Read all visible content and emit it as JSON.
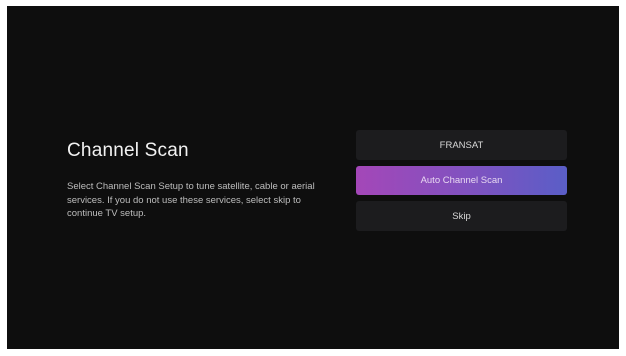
{
  "page": {
    "title": "Channel Scan",
    "description": "Select Channel Scan Setup to tune satellite, cable or aerial services. If you do not use these services, select skip to continue TV setup."
  },
  "menu": {
    "items": [
      {
        "label": "FRANSAT",
        "focused": false
      },
      {
        "label": "Auto Channel Scan",
        "focused": true
      },
      {
        "label": "Skip",
        "focused": false
      }
    ]
  },
  "colors": {
    "background": "#0e0e0e",
    "button": "#1c1c1e",
    "focus_gradient_start": "#a447b8",
    "focus_gradient_end": "#5a5ec7"
  }
}
